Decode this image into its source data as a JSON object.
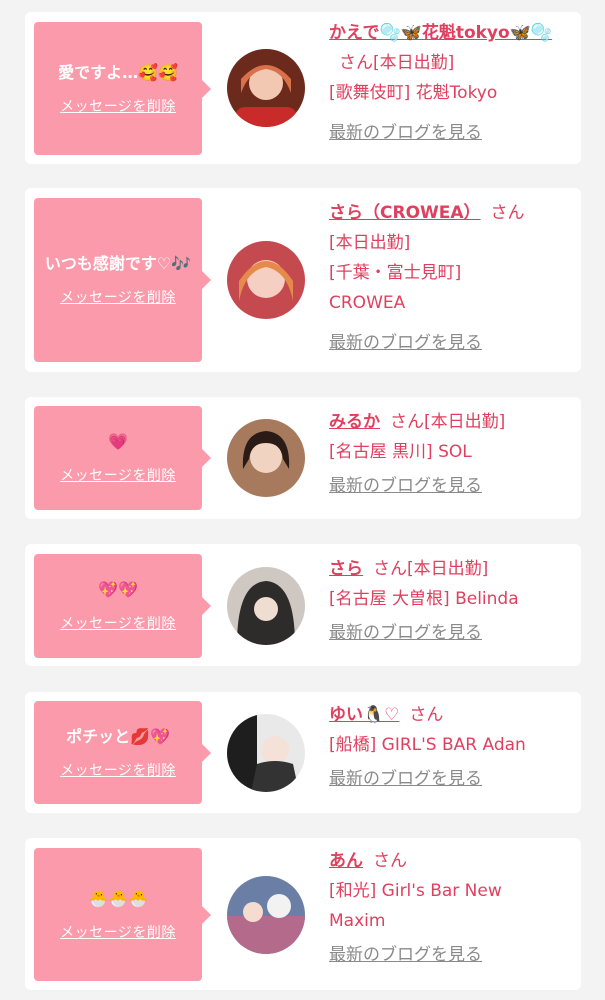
{
  "delete_label": "メッセージを削除",
  "blog_label": "最新のブログを見る",
  "san_label": "さん",
  "items": [
    {
      "message": "愛ですよ…🥰🥰",
      "name": "かえで🫧🦋花魁tokyo🦋🫧",
      "status": "[本日出勤]",
      "shop": "[歌舞伎町] 花魁Tokyo"
    },
    {
      "message": "いつも感謝です♡🎶",
      "name": "さら（CROWEA）",
      "status": "[本日出勤]",
      "shop": "[千葉・富士見町] CROWEA"
    },
    {
      "message": "💗",
      "name": "みるか",
      "status": "[本日出勤]",
      "shop": "[名古屋 黒川] SOL"
    },
    {
      "message": "💖💖",
      "name": "さら",
      "status": "[本日出勤]",
      "shop": "[名古屋 大曽根] Belinda"
    },
    {
      "message": "ポチッと💋💖",
      "name": "ゆい🐧♡",
      "status": "",
      "shop": "[船橋] GIRL'S BAR Adan"
    },
    {
      "message": "🐣🐣🐣",
      "name": "あん",
      "status": "",
      "shop": "[和光] Girl's Bar New Maxim"
    }
  ],
  "colors": {
    "accent": "#e0405f",
    "bubble": "#fb9aab",
    "card": "#ffffff",
    "background": "#f3f3f3",
    "link_gray": "#8a8a8a"
  }
}
